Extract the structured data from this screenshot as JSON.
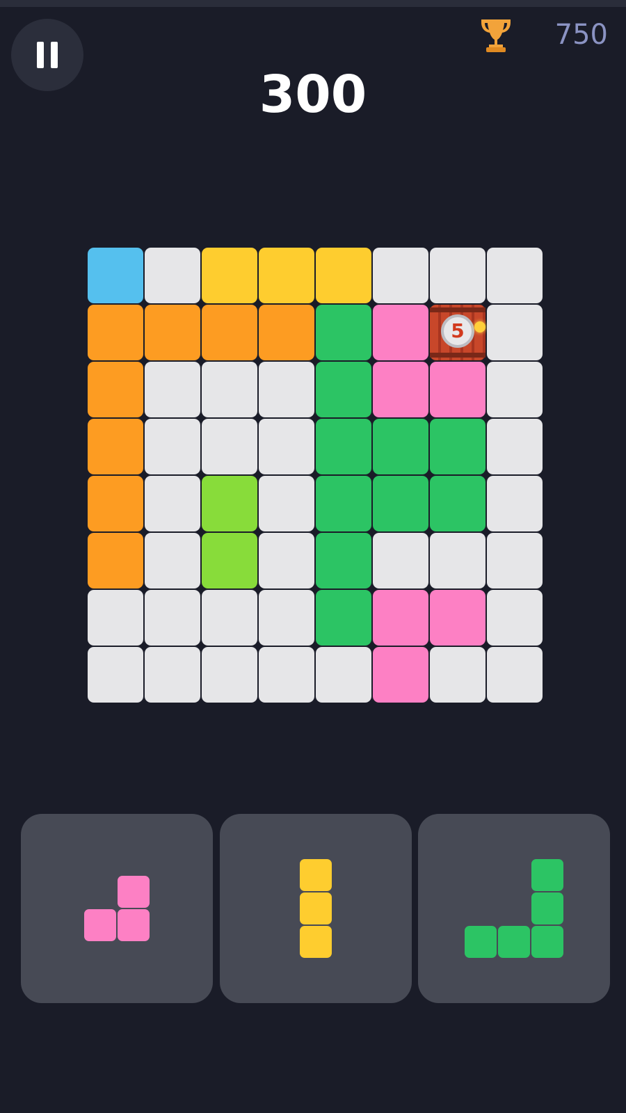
{
  "hud": {
    "score": "300",
    "best_score": "750",
    "pause_icon": "pause-icon",
    "trophy_icon": "trophy-icon"
  },
  "colors": {
    "background": "#1a1c28",
    "empty": "#e6e6e8",
    "blue": "#55c0ee",
    "yellow": "#fecd2f",
    "orange": "#fd9c22",
    "green": "#2cc464",
    "pink": "#fd80c4",
    "lime": "#88dc3a",
    "tray": "#474a55",
    "best_score_text": "#8b93c3"
  },
  "board": {
    "rows": 8,
    "cols": 8,
    "cells": [
      [
        "blue",
        "empty",
        "yellow",
        "yellow",
        "yellow",
        "empty",
        "empty",
        "empty"
      ],
      [
        "orange",
        "orange",
        "orange",
        "orange",
        "green",
        "pink",
        "bomb",
        "empty"
      ],
      [
        "orange",
        "empty",
        "empty",
        "empty",
        "green",
        "pink",
        "pink",
        "empty"
      ],
      [
        "orange",
        "empty",
        "empty",
        "empty",
        "green",
        "green",
        "green",
        "empty"
      ],
      [
        "orange",
        "empty",
        "lime",
        "empty",
        "green",
        "green",
        "green",
        "empty"
      ],
      [
        "orange",
        "empty",
        "lime",
        "empty",
        "green",
        "empty",
        "empty",
        "empty"
      ],
      [
        "empty",
        "empty",
        "empty",
        "empty",
        "green",
        "pink",
        "pink",
        "empty"
      ],
      [
        "empty",
        "empty",
        "empty",
        "empty",
        "empty",
        "pink",
        "empty",
        "empty"
      ]
    ],
    "bomb": {
      "row": 1,
      "col": 6,
      "countdown": "5",
      "icon": "bomb-icon"
    }
  },
  "tray": {
    "pieces": [
      {
        "name": "pink-l-piece",
        "color": "pink",
        "shape": [
          [
            0,
            1
          ],
          [
            1,
            1
          ]
        ]
      },
      {
        "name": "yellow-i-piece",
        "color": "yellow",
        "shape": [
          [
            1
          ],
          [
            1
          ],
          [
            1
          ]
        ]
      },
      {
        "name": "green-l-piece",
        "color": "green",
        "shape": [
          [
            0,
            0,
            1
          ],
          [
            0,
            0,
            1
          ],
          [
            1,
            1,
            1
          ]
        ]
      }
    ]
  }
}
